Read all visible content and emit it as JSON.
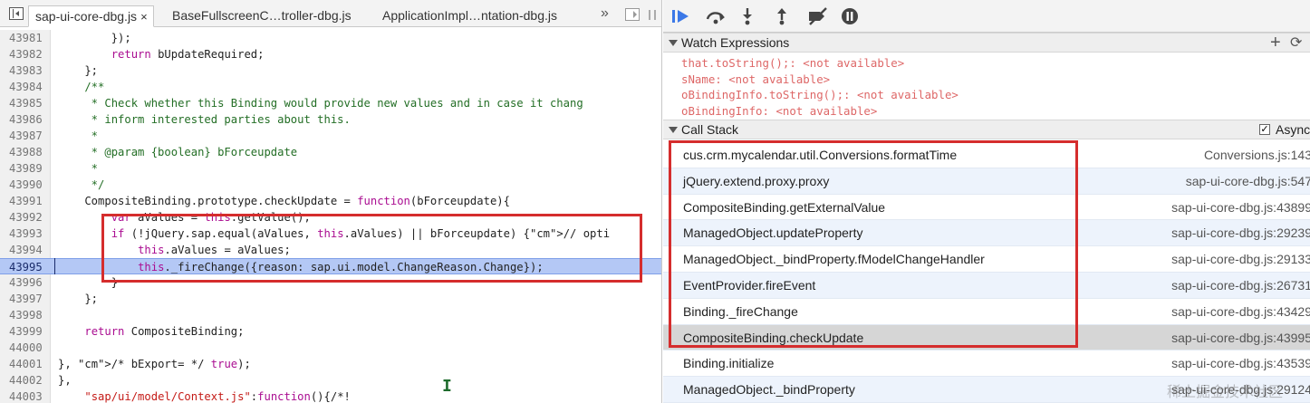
{
  "tabs": [
    {
      "label": "sap-ui-core-dbg.js",
      "active": true,
      "close": "×"
    },
    {
      "label": "BaseFullscreenC…troller-dbg.js",
      "active": false
    },
    {
      "label": "ApplicationImpl…ntation-dbg.js",
      "active": false
    }
  ],
  "more_tabs": "»",
  "code_lines": [
    {
      "n": "43981",
      "t": "        });"
    },
    {
      "n": "43982",
      "t": "        return bUpdateRequired;"
    },
    {
      "n": "43983",
      "t": "    };"
    },
    {
      "n": "43984",
      "t": "    /**"
    },
    {
      "n": "43985",
      "t": "     * Check whether this Binding would provide new values and in case it chang"
    },
    {
      "n": "43986",
      "t": "     * inform interested parties about this."
    },
    {
      "n": "43987",
      "t": "     *"
    },
    {
      "n": "43988",
      "t": "     * @param {boolean} bForceupdate"
    },
    {
      "n": "43989",
      "t": "     *"
    },
    {
      "n": "43990",
      "t": "     */"
    },
    {
      "n": "43991",
      "t": "    CompositeBinding.prototype.checkUpdate = function(bForceupdate){"
    },
    {
      "n": "43992",
      "t": "        var aValues = this.getValue();"
    },
    {
      "n": "43993",
      "t": "        if (!jQuery.sap.equal(aValues, this.aValues) || bForceupdate) {// opti"
    },
    {
      "n": "43994",
      "t": "            this.aValues = aValues;"
    },
    {
      "n": "43995",
      "t": "            this._fireChange({reason: sap.ui.model.ChangeReason.Change});",
      "exec": true
    },
    {
      "n": "43996",
      "t": "        }"
    },
    {
      "n": "43997",
      "t": "    };"
    },
    {
      "n": "43998",
      "t": ""
    },
    {
      "n": "43999",
      "t": "    return CompositeBinding;"
    },
    {
      "n": "44000",
      "t": ""
    },
    {
      "n": "44001",
      "t": "}, /* bExport= */ true);"
    },
    {
      "n": "44002",
      "t": "},"
    },
    {
      "n": "44003",
      "t": "    \"sap/ui/model/Context.js\":function(){/*!"
    }
  ],
  "watch": {
    "title": "Watch Expressions",
    "add_icon": "plus-icon",
    "refresh_icon": "refresh-icon",
    "items": [
      {
        "expr": "that.toString();",
        "value": "<not available>"
      },
      {
        "expr": "sName",
        "value": "<not available>"
      },
      {
        "expr": "oBindingInfo.toString();",
        "value": "<not available>"
      },
      {
        "expr": "oBindingInfo",
        "value": "<not available>"
      }
    ]
  },
  "call_stack": {
    "title": "Call Stack",
    "async_label": "Async",
    "async_checked": true,
    "frames": [
      {
        "fn": "cus.crm.mycalendar.util.Conversions.formatTime",
        "loc": "Conversions.js:143"
      },
      {
        "fn": "jQuery.extend.proxy.proxy",
        "loc": "sap-ui-core-dbg.js:547"
      },
      {
        "fn": "CompositeBinding.getExternalValue",
        "loc": "sap-ui-core-dbg.js:43899"
      },
      {
        "fn": "ManagedObject.updateProperty",
        "loc": "sap-ui-core-dbg.js:29239"
      },
      {
        "fn": "ManagedObject._bindProperty.fModelChangeHandler",
        "loc": "sap-ui-core-dbg.js:29133"
      },
      {
        "fn": "EventProvider.fireEvent",
        "loc": "sap-ui-core-dbg.js:26731"
      },
      {
        "fn": "Binding._fireChange",
        "loc": "sap-ui-core-dbg.js:43429"
      },
      {
        "fn": "CompositeBinding.checkUpdate",
        "loc": "sap-ui-core-dbg.js:43995",
        "selected": true
      },
      {
        "fn": "Binding.initialize",
        "loc": "sap-ui-core-dbg.js:43539"
      },
      {
        "fn": "ManagedObject._bindProperty",
        "loc": "sap-ui-core-dbg.js:29124"
      }
    ]
  },
  "watermark": "稀土掘金技术社区",
  "colors": {
    "highlight_box": "#d52d2d",
    "exec_line": "#b4c8f5",
    "debug_accent": "#3b78e7"
  }
}
